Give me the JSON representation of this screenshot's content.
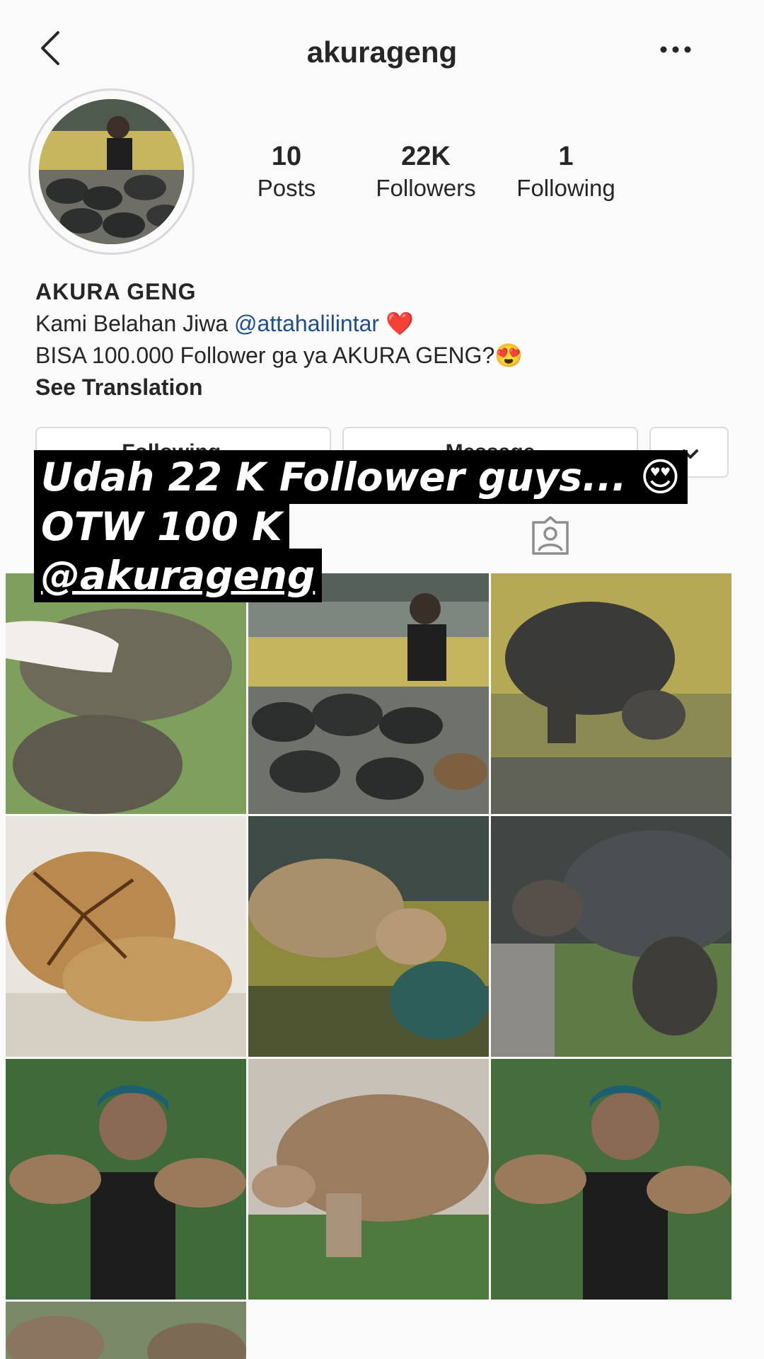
{
  "header": {
    "username": "akurageng",
    "back_icon": "chevron-left-icon",
    "more_icon": "ellipsis-icon"
  },
  "stats": {
    "posts": {
      "value": "10",
      "label": "Posts"
    },
    "followers": {
      "value": "22K",
      "label": "Followers"
    },
    "following": {
      "value": "1",
      "label": "Following"
    }
  },
  "bio": {
    "name": "AKURA GENG",
    "line1_text": "Kami Belahan Jiwa ",
    "line1_mention": "@attahalilintar",
    "line1_emoji": "❤️",
    "line2_text": "BISA 100.000 Follower ga ya AKURA GENG?",
    "line2_emoji": "😍",
    "see_translation": "See Translation"
  },
  "buttons": {
    "following": "Following ⌄",
    "message": "Message",
    "dropdown_icon": "chevron-down-icon"
  },
  "tabs": {
    "grid_icon": "grid-icon",
    "tagged_icon": "tagged-person-icon"
  },
  "story_overlay": {
    "line1": "Udah 22 K Follower guys... 😍",
    "line2": "OTW 100 K",
    "line3": "@akurageng"
  },
  "posts": [
    {
      "subject": "hand-holding-tortoise",
      "bg": "#8aa56c"
    },
    {
      "subject": "man-with-tortoises",
      "bg": "#4d5a52"
    },
    {
      "subject": "dark-tortoise-walking",
      "bg": "#6f7a4a"
    },
    {
      "subject": "sulcata-tortoises-stacked",
      "bg": "#c9a06a"
    },
    {
      "subject": "sulcata-and-teal-tortoise",
      "bg": "#4f6a45"
    },
    {
      "subject": "tortoise-eating-grass",
      "bg": "#5a6058"
    },
    {
      "subject": "man-holding-two-tortoises",
      "bg": "#3f6a3a"
    },
    {
      "subject": "large-sulcata-on-grass",
      "bg": "#9a8d78"
    },
    {
      "subject": "man-holding-two-tortoises-2",
      "bg": "#466e3c"
    },
    {
      "subject": "tortoise-partial",
      "bg": "#7a8a68"
    }
  ],
  "colors": {
    "background": "#fafafa",
    "text": "#262626",
    "mention": "#1f4e8c",
    "border": "#dbdbdb"
  }
}
